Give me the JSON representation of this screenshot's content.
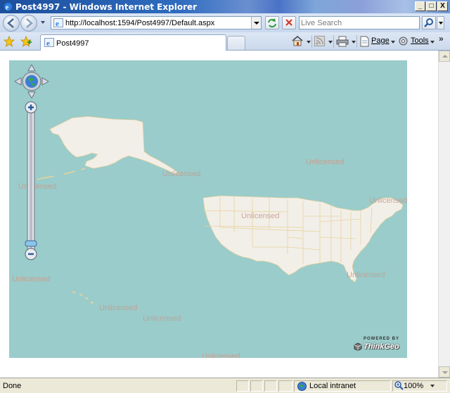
{
  "window": {
    "title": "Post4997 - Windows Internet Explorer",
    "minimize": "_",
    "maximize": "□",
    "close": "X"
  },
  "address": {
    "url": "http://localhost:1594/Post4997/Default.aspx"
  },
  "search": {
    "placeholder": "Live Search"
  },
  "tab": {
    "label": "Post4997"
  },
  "commands": {
    "page": "Page",
    "tools": "Tools"
  },
  "map": {
    "watermarks": [
      "Unlicensed",
      "Unlicensed",
      "Unlicensed",
      "Unlicensed",
      "Unlicensed",
      "Unlicensed",
      "Unlicensed",
      "Unlicensed",
      "Unlicensed",
      "Unlicensed"
    ],
    "logo_top": "POWERED BY",
    "logo_main": "ThinkGeo",
    "colors": {
      "water": "#9acccb",
      "land": "#f2efe9",
      "border": "#e8d29a"
    }
  },
  "status": {
    "text": "Done",
    "zone": "Local intranet",
    "zoom": "100%"
  },
  "icons": [
    "ie-logo-icon",
    "back-icon",
    "forward-icon",
    "refresh-icon",
    "stop-icon",
    "search-icon",
    "favorites-star-icon",
    "add-favorites-icon",
    "home-icon",
    "feeds-icon",
    "print-icon",
    "page-icon",
    "tools-gear-icon",
    "globe-icon",
    "zoom-icon"
  ]
}
